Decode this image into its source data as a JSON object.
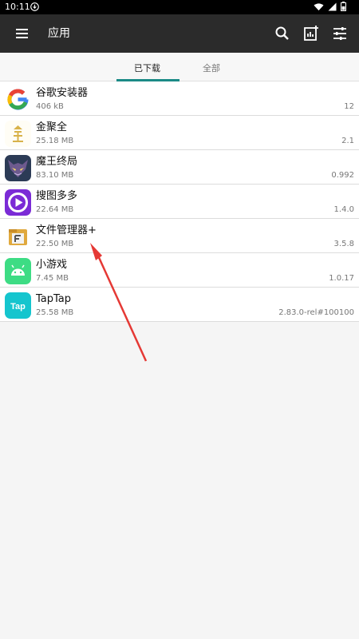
{
  "status": {
    "time": "10:11",
    "download_icon": "download-icon",
    "wifi_icon": "wifi-icon",
    "signal_icon": "signal-icon",
    "battery_icon": "battery-icon"
  },
  "appbar": {
    "title": "应用",
    "menu_icon": "menu-icon",
    "search_icon": "search-icon",
    "stats_icon": "chart-add-icon",
    "filter_icon": "tune-icon"
  },
  "tabs": [
    {
      "label": "已下载",
      "active": true
    },
    {
      "label": "全部",
      "active": false
    }
  ],
  "apps": [
    {
      "name": "谷歌安装器",
      "size": "406 kB",
      "version": "12",
      "icon": "google-icon"
    },
    {
      "name": "金聚全",
      "size": "25.18 MB",
      "version": "2.1",
      "icon": "gold-logo-icon"
    },
    {
      "name": "魔王终局",
      "size": "83.10 MB",
      "version": "0.992",
      "icon": "demon-king-icon"
    },
    {
      "name": "搜图多多",
      "size": "22.64 MB",
      "version": "1.4.0",
      "icon": "play-circle-icon"
    },
    {
      "name": "文件管理器+",
      "size": "22.50 MB",
      "version": "3.5.8",
      "icon": "file-manager-icon"
    },
    {
      "name": "小游戏",
      "size": "7.45 MB",
      "version": "1.0.17",
      "icon": "android-icon"
    },
    {
      "name": "TapTap",
      "size": "25.58 MB",
      "version": "2.83.0-rel#100100",
      "icon": "taptap-icon"
    }
  ],
  "colors": {
    "appbar": "#2b2b2b",
    "accent": "#1b8a86",
    "annotation_arrow": "#e53935"
  }
}
